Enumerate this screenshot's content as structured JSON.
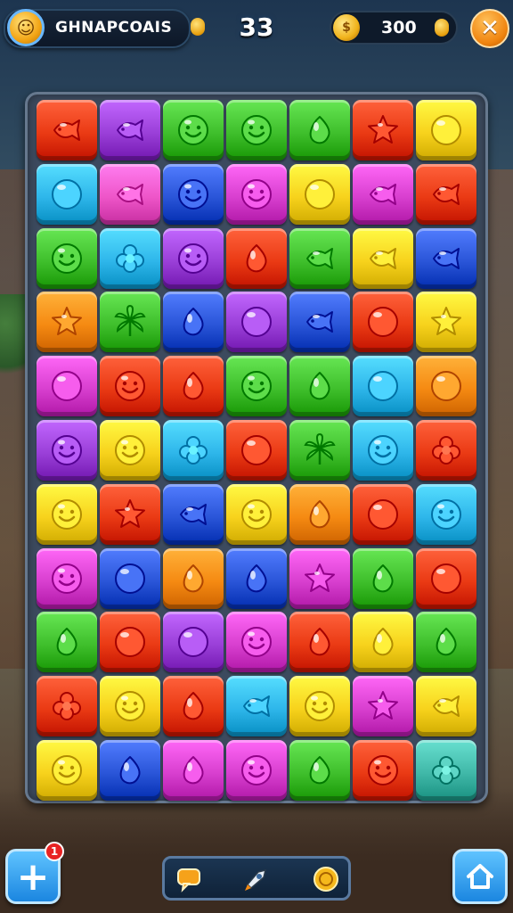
{
  "hud": {
    "player_name": "GHNAPCOAIS",
    "moves": "33",
    "coins": "300",
    "close_label": "✕"
  },
  "bottom": {
    "add_label": "+",
    "badge_count": "1"
  },
  "board": {
    "rows": [
      [
        [
          "red",
          "fish"
        ],
        [
          "purple",
          "fish"
        ],
        [
          "green",
          "smile"
        ],
        [
          "green",
          "smile"
        ],
        [
          "green",
          "drop"
        ],
        [
          "red",
          "star"
        ],
        [
          "yellow",
          "orb"
        ]
      ],
      [
        [
          "cyan",
          "orb"
        ],
        [
          "pink",
          "fish"
        ],
        [
          "blue",
          "smile"
        ],
        [
          "magenta",
          "smile"
        ],
        [
          "yellow",
          "orb"
        ],
        [
          "magenta",
          "fish"
        ],
        [
          "red",
          "fish"
        ]
      ],
      [
        [
          "green",
          "smile"
        ],
        [
          "cyan",
          "flower"
        ],
        [
          "purple",
          "smile"
        ],
        [
          "red",
          "drop"
        ],
        [
          "green",
          "fish"
        ],
        [
          "yellow",
          "fish"
        ],
        [
          "blue",
          "fish"
        ]
      ],
      [
        [
          "orange",
          "star"
        ],
        [
          "green",
          "leaf"
        ],
        [
          "blue",
          "drop"
        ],
        [
          "purple",
          "orb"
        ],
        [
          "blue",
          "fish"
        ],
        [
          "red",
          "orb"
        ],
        [
          "yellow",
          "star"
        ]
      ],
      [
        [
          "magenta",
          "orb"
        ],
        [
          "red",
          "smile"
        ],
        [
          "red",
          "drop"
        ],
        [
          "green",
          "smile"
        ],
        [
          "green",
          "drop"
        ],
        [
          "cyan",
          "orb"
        ],
        [
          "orange",
          "orb"
        ]
      ],
      [
        [
          "purple",
          "smile"
        ],
        [
          "yellow",
          "smile"
        ],
        [
          "cyan",
          "flower"
        ],
        [
          "red",
          "orb"
        ],
        [
          "green",
          "leaf"
        ],
        [
          "cyan",
          "smile"
        ],
        [
          "red",
          "flower"
        ]
      ],
      [
        [
          "yellow",
          "smile"
        ],
        [
          "red",
          "star"
        ],
        [
          "blue",
          "fish"
        ],
        [
          "yellow",
          "smile"
        ],
        [
          "orange",
          "drop"
        ],
        [
          "red",
          "orb"
        ],
        [
          "cyan",
          "smile"
        ]
      ],
      [
        [
          "magenta",
          "smile"
        ],
        [
          "blue",
          "orb"
        ],
        [
          "orange",
          "drop"
        ],
        [
          "blue",
          "drop"
        ],
        [
          "magenta",
          "star"
        ],
        [
          "green",
          "drop"
        ],
        [
          "red",
          "orb"
        ]
      ],
      [
        [
          "green",
          "drop"
        ],
        [
          "red",
          "orb"
        ],
        [
          "purple",
          "orb"
        ],
        [
          "magenta",
          "smile"
        ],
        [
          "red",
          "drop"
        ],
        [
          "yellow",
          "drop"
        ],
        [
          "green",
          "drop"
        ]
      ],
      [
        [
          "red",
          "flower"
        ],
        [
          "yellow",
          "smile"
        ],
        [
          "red",
          "drop"
        ],
        [
          "cyan",
          "fish"
        ],
        [
          "yellow",
          "smile"
        ],
        [
          "magenta",
          "star"
        ],
        [
          "yellow",
          "fish"
        ]
      ],
      [
        [
          "yellow",
          "smile"
        ],
        [
          "blue",
          "drop"
        ],
        [
          "magenta",
          "drop"
        ],
        [
          "magenta",
          "smile"
        ],
        [
          "green",
          "drop"
        ],
        [
          "red",
          "smile"
        ],
        [
          "teal",
          "flower"
        ]
      ]
    ]
  },
  "colors": {
    "red": "#ea3a14",
    "orange": "#f58a12",
    "yellow": "#f7d21c",
    "green": "#3fbf2c",
    "cyan": "#2eb6ea",
    "blue": "#2a55d8",
    "purple": "#9a3fd8",
    "magenta": "#d83fcf",
    "pink": "#ee55c8",
    "teal": "#40b8a8"
  },
  "icons": {
    "add": "plus-icon",
    "close": "close-icon",
    "home": "home-icon",
    "tool_1": "speech-bubble-icon",
    "tool_2": "rocket-icon",
    "tool_3": "coin-icon"
  }
}
